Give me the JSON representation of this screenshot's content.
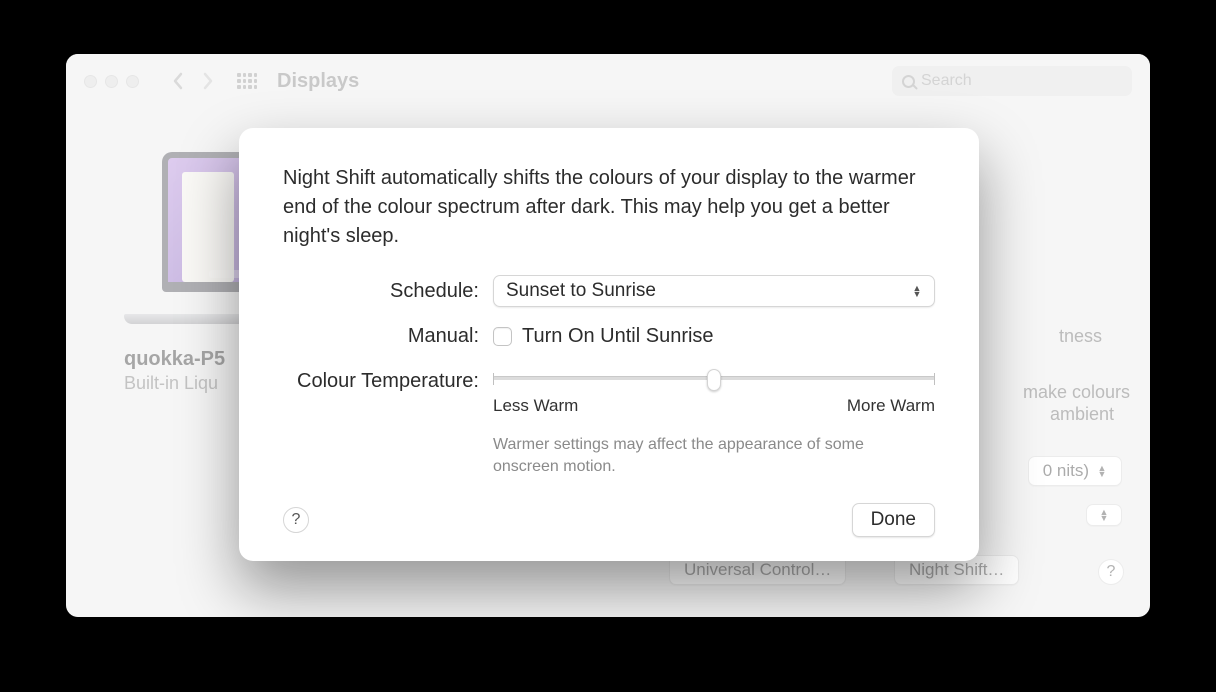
{
  "window": {
    "title": "Displays",
    "search_placeholder": "Search"
  },
  "device": {
    "name": "quokka-P5",
    "subtitle": "Built-in Liqu"
  },
  "bg_right": {
    "brightness": "tness",
    "desc1": " make colours",
    "desc2": " ambient",
    "nits": "0 nits)",
    "universal": "Universal Control…",
    "nightshift": "Night Shift…"
  },
  "sheet": {
    "description": "Night Shift automatically shifts the colours of your display to the warmer end of the colour spectrum after dark. This may help you get a better night's sleep.",
    "schedule_label": "Schedule:",
    "schedule_value": "Sunset to Sunrise",
    "manual_label": "Manual:",
    "manual_checkbox_label": "Turn On Until Sunrise",
    "manual_checked": false,
    "temp_label": "Colour Temperature:",
    "slider_position_pct": 50,
    "slider_less": "Less Warm",
    "slider_more": "More Warm",
    "slider_note": "Warmer settings may affect the appearance of some onscreen motion.",
    "help": "?",
    "done": "Done"
  }
}
